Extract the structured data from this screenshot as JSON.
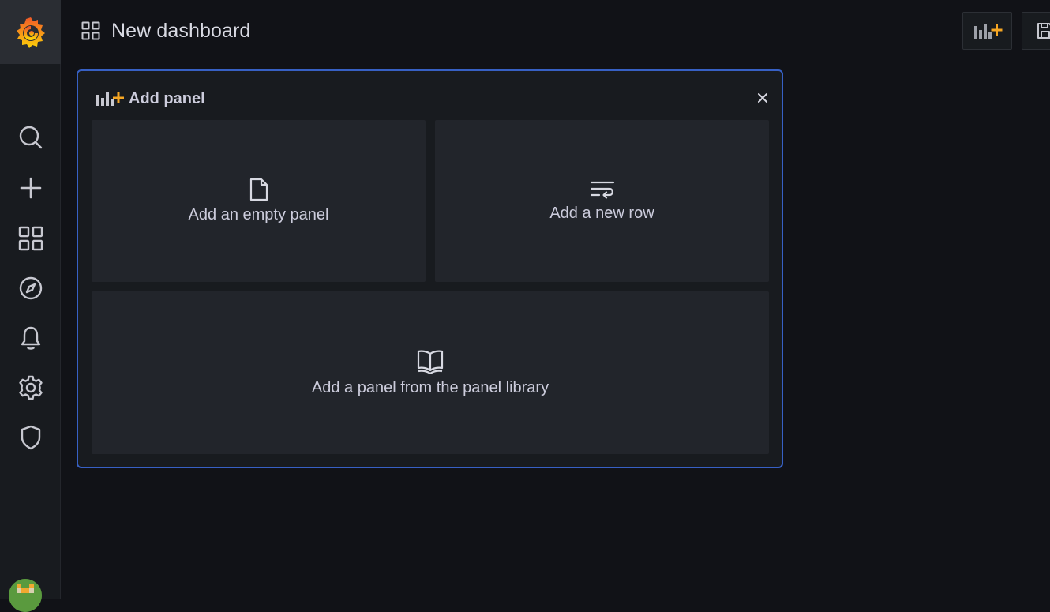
{
  "header": {
    "title": "New dashboard",
    "title_icon": "apps-icon",
    "buttons": [
      {
        "name": "add-panel-button",
        "icon": "panel-add-icon"
      },
      {
        "name": "save-dashboard-button",
        "icon": "save-icon"
      }
    ]
  },
  "sidebar": {
    "logo": "grafana-logo",
    "items": [
      {
        "name": "search",
        "icon": "search-icon"
      },
      {
        "name": "create",
        "icon": "plus-icon"
      },
      {
        "name": "dashboards",
        "icon": "apps-icon"
      },
      {
        "name": "explore",
        "icon": "compass-icon"
      },
      {
        "name": "alerting",
        "icon": "bell-icon"
      },
      {
        "name": "configuration",
        "icon": "gear-icon"
      },
      {
        "name": "server-admin",
        "icon": "shield-icon"
      }
    ],
    "avatar": "user-avatar"
  },
  "add_panel": {
    "title": "Add panel",
    "options": {
      "empty": "Add an empty panel",
      "row": "Add a new row",
      "library": "Add a panel from the panel library"
    }
  },
  "colors": {
    "background": "#111217",
    "sidebar": "#181b1f",
    "panel_border": "#3760c4",
    "option_bg": "#22252b",
    "accent_orange": "#f5a623"
  }
}
